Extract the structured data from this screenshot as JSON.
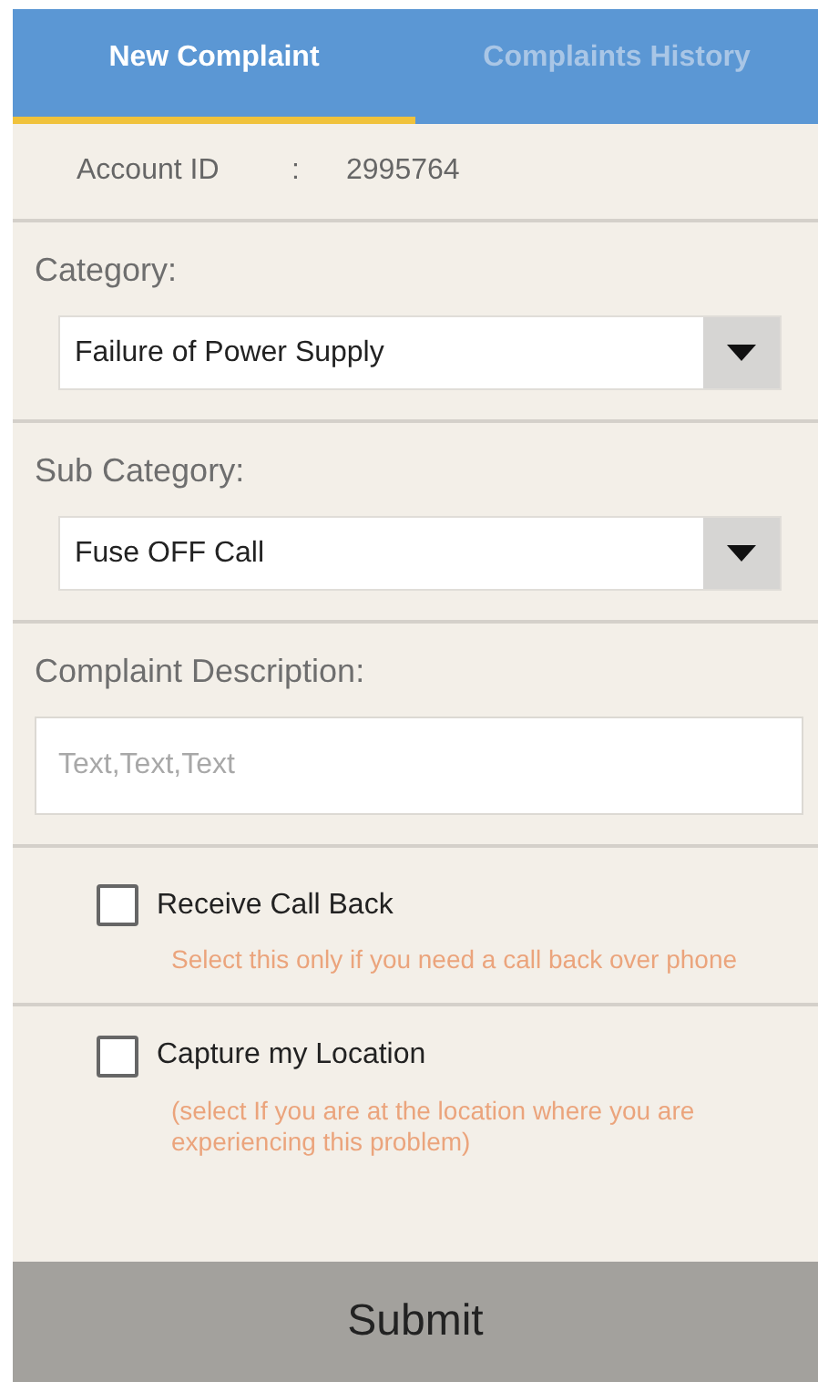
{
  "tabs": [
    {
      "label": "New Complaint",
      "selected": true
    },
    {
      "label": "Complaints History",
      "selected": false
    }
  ],
  "account": {
    "label": "Account ID",
    "separator": ":",
    "value": "2995764"
  },
  "dropdowns": [
    {
      "label": "Category:",
      "value": "Failure of Power Supply"
    },
    {
      "label": "Sub Category:",
      "value": "Fuse OFF Call"
    }
  ],
  "description": {
    "label": "Complaint Description:",
    "placeholder": "Text,Text,Text"
  },
  "options": [
    {
      "label": "Receive Call Back",
      "checked": false,
      "hint": "Select this only if you need a call back over phone"
    },
    {
      "label": "Capture my Location",
      "checked": false,
      "hint": "(select If you are at the location where you are experiencing this problem)"
    }
  ],
  "submit": "Submit"
}
